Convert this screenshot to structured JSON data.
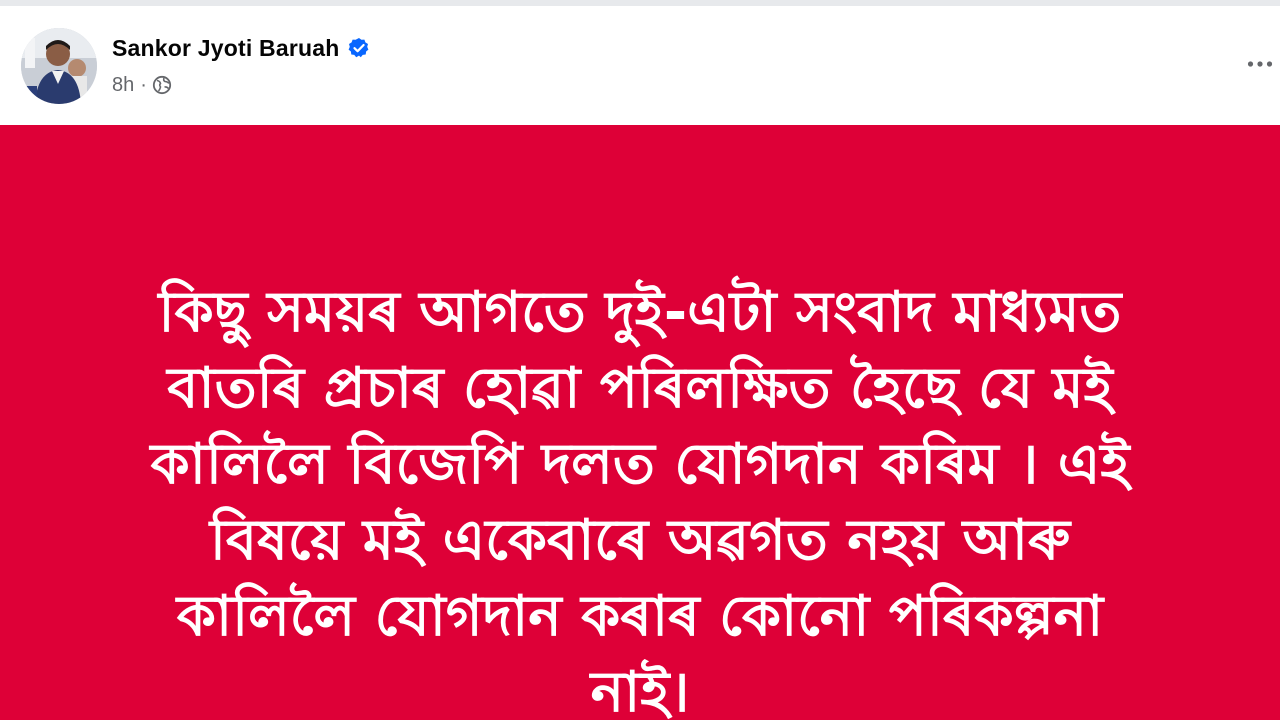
{
  "post": {
    "author": "Sankor Jyoti Baruah",
    "time": "8h",
    "separator": "·",
    "audience_icon": "globe-icon",
    "verified_icon": "verified-badge-icon",
    "more_icon": "more-options-icon"
  },
  "image": {
    "background_color": "#de0037",
    "text_color": "#ffffff",
    "text": "কিছু সময়ৰ আগতে দুই-এটা সংবাদ মাধ্যমত\nবাতৰি প্ৰচাৰ হোৱা পৰিলক্ষিত হৈছে যে মই\nকালিলৈ বিজেপি দলত যোগদান কৰিম । এই\nবিষয়ে মই একেবাৰে অৱগত নহয় আৰু\nকালিলৈ যোগদান কৰাৰ কোনো পৰিকল্পনা\nনাই।"
  },
  "colors": {
    "verified": "#0866ff",
    "meta_text": "#65676b",
    "name_text": "#050505"
  }
}
